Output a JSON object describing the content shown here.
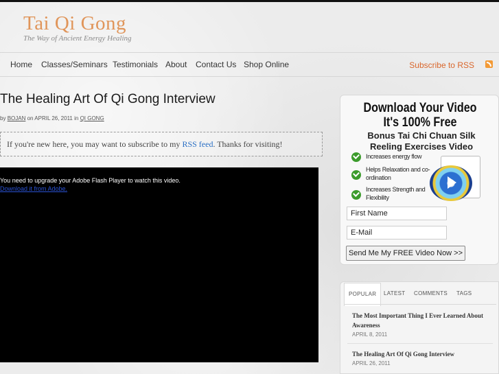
{
  "site": {
    "title": "Tai Qi Gong",
    "tagline": "The Way of Ancient Energy Healing"
  },
  "nav": {
    "items": [
      {
        "label": "Home"
      },
      {
        "label": "Classes/Seminars"
      },
      {
        "label": "Testimonials"
      },
      {
        "label": "About"
      },
      {
        "label": "Contact Us"
      },
      {
        "label": "Shop Online"
      }
    ],
    "rss_label": "Subscribe to RSS",
    "rss_icon": "rss-icon"
  },
  "post": {
    "title": "The Healing Art Of Qi Gong Interview",
    "meta_by": "by",
    "author": "BOJAN",
    "meta_on": "on APRIL 26, 2011 in",
    "category": "QI GONG"
  },
  "notice": {
    "before": "If you're new here, you may want to subscribe to my",
    "link": "RSS feed",
    "after": ". Thanks for visiting!"
  },
  "video": {
    "message": "You need to upgrade your Adobe Flash Player to watch this video.",
    "link": "Download it from Adobe."
  },
  "optin": {
    "headline1": "Download Your Video",
    "headline2": "It's 100% Free",
    "subhead": "Bonus Tai Chi Chuan Silk Reeling Exercises Video",
    "bullets": [
      "Increases energy flow",
      "Helps Relaxation and co-ordination",
      "Increases Strength and Flexibility"
    ],
    "first_name_placeholder": "First Name",
    "email_placeholder": "E-Mail",
    "submit_label": "Send Me My FREE Video Now >>",
    "accent_color": "#3c9b2c"
  },
  "tabs": {
    "items": [
      "POPULAR",
      "LATEST",
      "COMMENTS",
      "TAGS"
    ],
    "active": "POPULAR",
    "posts": [
      {
        "title": "The Most Important Thing I Ever Learned About Awareness",
        "date": "APRIL 8, 2011"
      },
      {
        "title": "The Healing Art Of Qi Gong Interview",
        "date": "APRIL 26, 2011"
      }
    ]
  },
  "colors": {
    "brand": "#e0955a",
    "rss": "#d9662b",
    "link": "#2a6fc4"
  }
}
